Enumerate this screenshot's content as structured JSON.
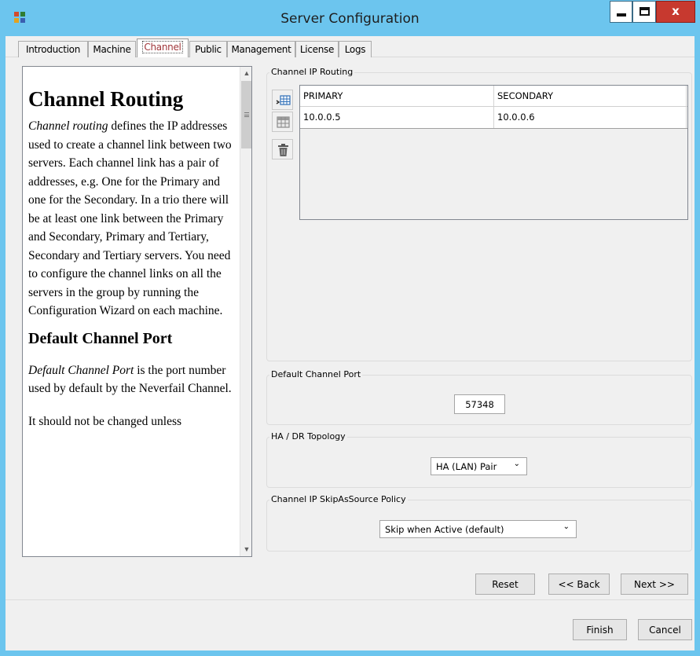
{
  "window": {
    "title": "Server Configuration",
    "close_glyph": "x"
  },
  "tabs": [
    {
      "label": "Introduction",
      "active": false
    },
    {
      "label": "Machine",
      "active": false
    },
    {
      "label": "Channel",
      "active": true
    },
    {
      "label": "Public",
      "active": false
    },
    {
      "label": "Management",
      "active": false
    },
    {
      "label": "License",
      "active": false
    },
    {
      "label": "Logs",
      "active": false
    }
  ],
  "help": {
    "heading1": "Channel Routing",
    "p1_em": "Channel routing",
    "p1_rest": " defines the IP addresses used to create a channel link between two servers. Each channel link has a pair of addresses, e.g. One for the Primary and one for the Secondary. In a trio there will be at least one link between the Primary and Secondary, Primary and Tertiary, Secondary and Tertiary servers. You need to configure the channel links on all the servers in the group by running the Configuration Wizard on each machine.",
    "heading2": "Default Channel Port",
    "p2_em": "Default Channel Port",
    "p2_rest": " is the port number used by default by the Neverfail Channel.",
    "p3": "It should not be changed unless"
  },
  "routing": {
    "group_label": "Channel IP Routing",
    "columns": [
      "PRIMARY",
      "SECONDARY"
    ],
    "rows": [
      {
        "primary": "10.0.0.5",
        "secondary": "10.0.0.6"
      }
    ]
  },
  "port": {
    "group_label": "Default Channel Port",
    "value": "57348"
  },
  "topology": {
    "group_label": "HA / DR Topology",
    "selected": "HA (LAN) Pair"
  },
  "skip_policy": {
    "group_label": "Channel IP SkipAsSource Policy",
    "selected": "Skip when Active (default)"
  },
  "buttons": {
    "reset": "Reset",
    "back": "<< Back",
    "next": "Next >>",
    "finish": "Finish",
    "cancel": "Cancel"
  },
  "colors": {
    "titlebar": "#6cc5ee",
    "close_button": "#c7392f",
    "active_tab_text": "#a0373b"
  }
}
